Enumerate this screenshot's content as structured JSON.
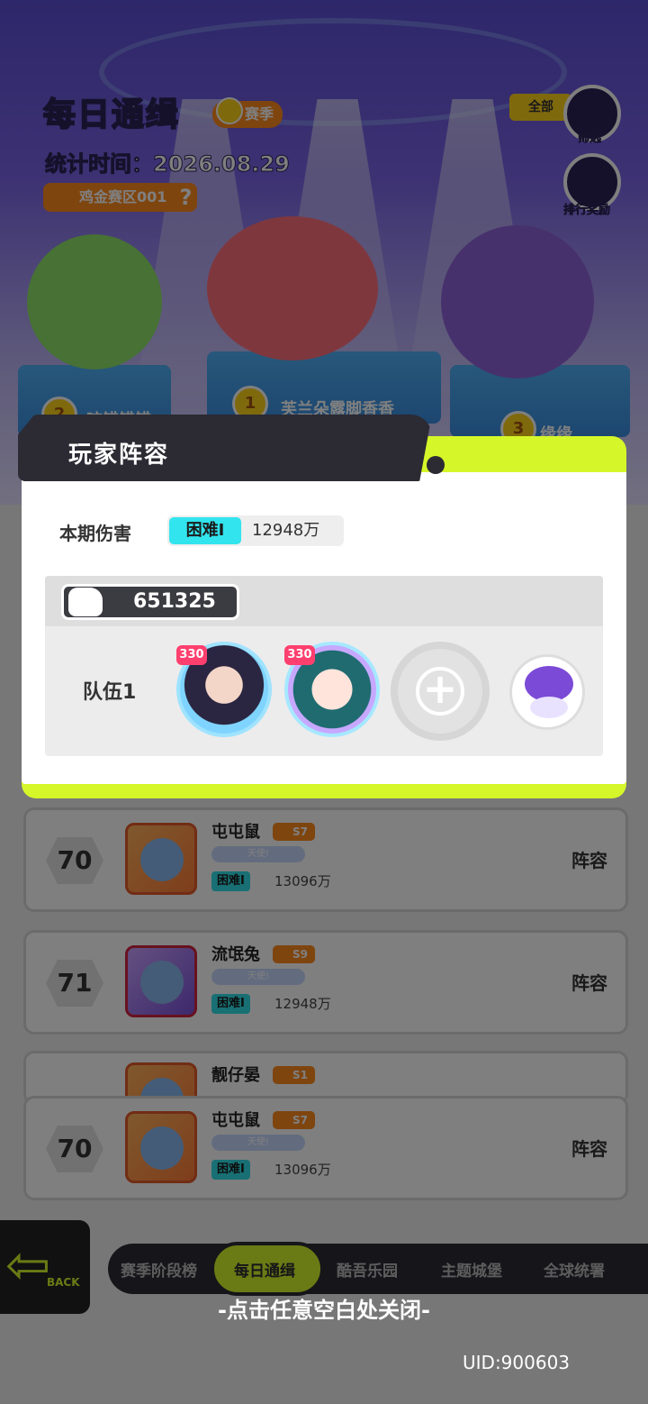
{
  "header": {
    "title": "每日通缉",
    "season_badge": "赛季",
    "stat_time": "统计时间：2026.08.29",
    "region": "鸡金赛区001",
    "filter_all": "全部",
    "filter_label": "筛选",
    "rank_reward_label": "排行奖励"
  },
  "podium": {
    "second_rank": "2",
    "second_name": "咬错错错",
    "first_rank": "1",
    "first_name": "芙兰朵露脚香香",
    "third_rank": "3",
    "third_name": "缘缘"
  },
  "modal": {
    "title": "玩家阵容",
    "damage_label": "本期伤害",
    "difficulty": "困难I",
    "damage_value": "12948万",
    "power": "651325",
    "team_label": "队伍1",
    "heroes": [
      {
        "level": "330"
      },
      {
        "level": "330"
      }
    ]
  },
  "rows": [
    {
      "rank": "70",
      "name": "屯屯鼠",
      "season": "S7",
      "tag": "天使!",
      "difficulty": "困难I",
      "damage": "13096万",
      "lineup": "阵容"
    },
    {
      "rank": "71",
      "name": "流氓兔",
      "season": "S9",
      "tag": "天使!",
      "difficulty": "困难I",
      "damage": "12948万",
      "lineup": "阵容"
    },
    {
      "rank": "",
      "name": "靓仔晏",
      "season": "S1",
      "tag": "",
      "difficulty": "",
      "damage": "",
      "lineup": ""
    },
    {
      "rank": "70",
      "name": "屯屯鼠",
      "season": "S7",
      "tag": "天使!",
      "difficulty": "困难I",
      "damage": "13096万",
      "lineup": "阵容"
    }
  ],
  "nav": {
    "back": "BACK",
    "items": [
      "赛季阶段榜",
      "每日通缉",
      "酷吾乐园",
      "主题城堡",
      "全球统署"
    ]
  },
  "close_hint": "-点击任意空白处关闭-",
  "uid": "UID:900603",
  "colors": {
    "accent": "#d5f72a",
    "dark": "#2c2a33",
    "difficulty": "#32e4ee",
    "badge": "#ff8a1f"
  }
}
